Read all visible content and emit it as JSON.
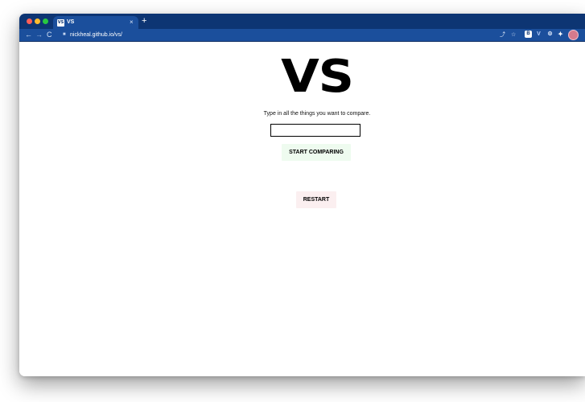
{
  "browser": {
    "tab": {
      "favicon_text": "VS",
      "title": "VS",
      "close_glyph": "×"
    },
    "new_tab_glyph": "+",
    "address": {
      "url": "nickheal.github.io/vs/",
      "lock_icon": "lock-icon"
    },
    "toolbar_icons": {
      "back": "←",
      "forward": "→",
      "reload": "C",
      "share": "⤴",
      "star": "☆",
      "ext_b": "B",
      "ext_v": "V",
      "ext_gear": "⚙",
      "ext_puzzle": "✦"
    },
    "colors": {
      "tab_bar": "#0d3573",
      "toolbar": "#1b4f9c",
      "start_button": "#eefbef",
      "restart_button": "#fbeff0"
    }
  },
  "page": {
    "logo": "VS",
    "prompt": "Type in all the things you want to compare.",
    "input": {
      "value": "",
      "placeholder": ""
    },
    "start_button": "START COMPARING",
    "restart_button": "RESTART"
  }
}
